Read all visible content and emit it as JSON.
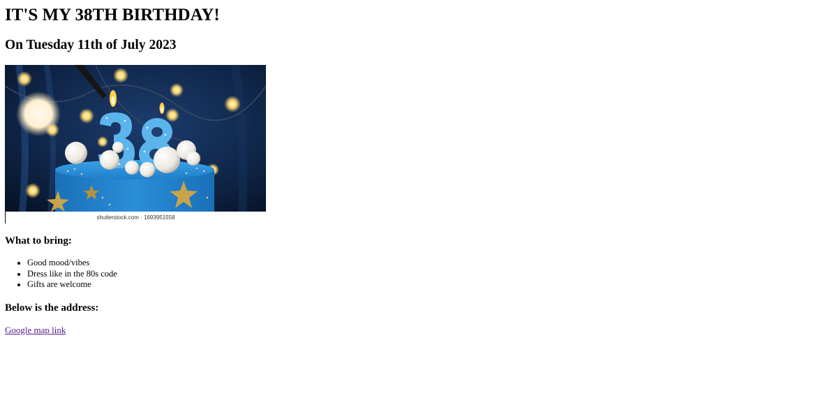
{
  "heading": "IT'S MY 38TH BIRTHDAY!",
  "date_line": "On Tuesday 11th of July 2023",
  "image": {
    "caption": "shutterstock.com · 1693951558",
    "depicts": "blue birthday cake with number 38 candles and bokeh lights",
    "colors": {
      "background": "#0d1a33",
      "cake": "#2a8fd8",
      "candle": "#5bb4ec",
      "star": "#c9a44a",
      "ball": "#f2f0ea",
      "light": "#ffd76a"
    }
  },
  "bring": {
    "heading": "What to bring:",
    "items": [
      "Good mood/vibes",
      "Dress like in the 80s code",
      "Gifts are welcome"
    ]
  },
  "address": {
    "heading": "Below is the address:",
    "link_text": "Google map link",
    "link_color": "#551a8b"
  }
}
